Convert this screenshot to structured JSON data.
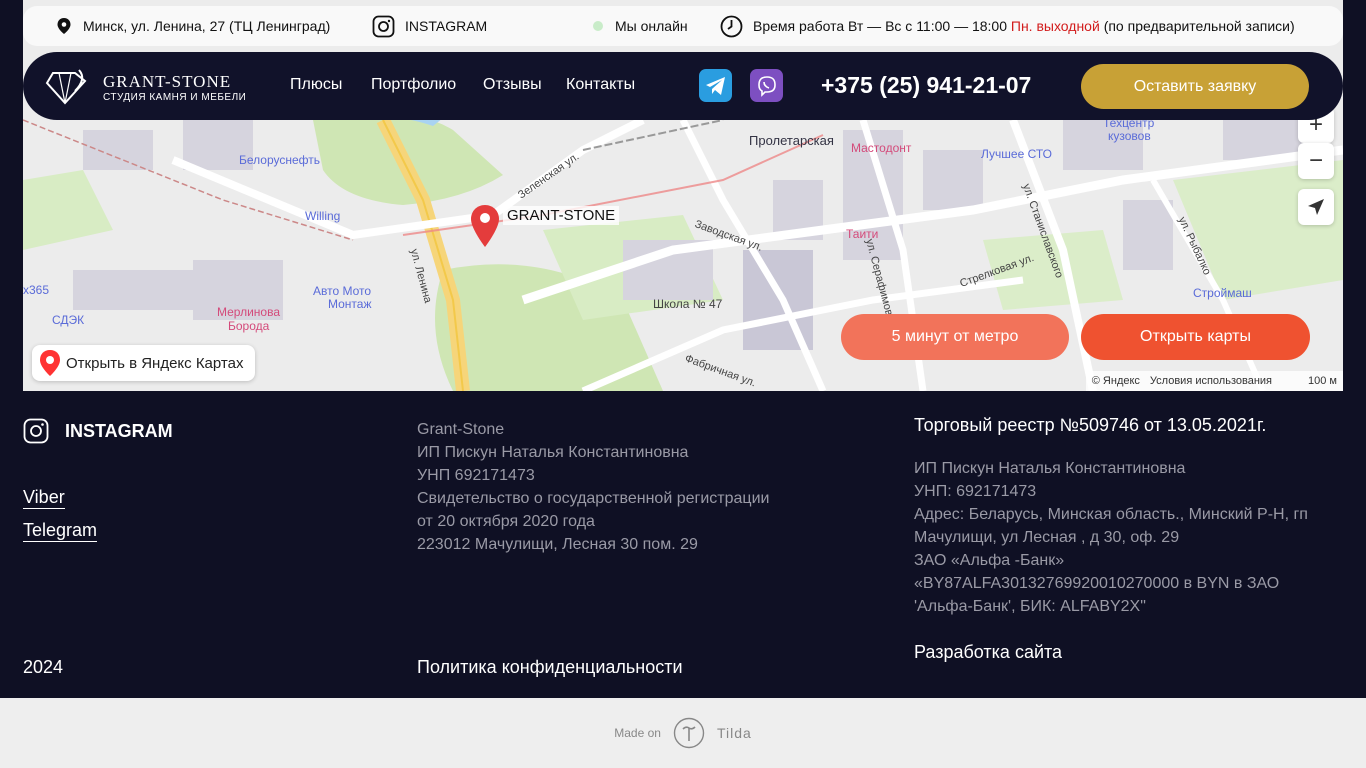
{
  "infobar": {
    "address": "Минск, ул. Ленина, 27 (ТЦ Ленинград)",
    "instagram": "INSTAGRAM",
    "online": "Мы онлайн",
    "hours_prefix": "Время работа Вт — Вс с 11:00 — 18:00",
    "hours_dayoff": "Пн. выходной",
    "hours_suffix": "(по предварительной записи)"
  },
  "navbar": {
    "logo_title": "GRANT-STONE",
    "logo_subtitle": "СТУДИЯ КАМНЯ И МЕБЕЛИ",
    "menu": [
      "Плюсы",
      "Портфолио",
      "Отзывы",
      "Контакты"
    ],
    "phone": "+375 (25) 941-21-07",
    "cta": "Оставить заявку"
  },
  "map": {
    "pin_label": "GRANT-STONE",
    "labels": {
      "metro": "Пролетарская",
      "mastodont": "Мастодонт",
      "sto": "Лучшее СТО",
      "techcentr1": "Техцентр",
      "techcentr2": "кузовов",
      "belorusneft": "Белоруснефть",
      "willing": "Willing",
      "avtomoto1": "Авто Мото",
      "avtomoto2": "Монтаж",
      "merlinova1": "Мерлинова",
      "merlinova2": "Борода",
      "sdek": "СДЭК",
      "school": "Школа № 47",
      "taiti": "Таити",
      "stroymash": "Строймаш",
      "x365": "x365",
      "zavodskaya": "Заводская ул.",
      "lenina": "ул. Ленина",
      "strelkovaya": "Стрелковая ул.",
      "stanislavskogo": "ул. Станиславского",
      "rybalko": "ул. Рыбалко",
      "fabrichnaya": "Фабричная ул.",
      "zelenskaya": "Зеленская ул.",
      "serafimovicha": "ул. Серафимовича"
    },
    "open_yandex": "Открыть в Яндекс Картах",
    "metro_button": "5 минут от метро",
    "maps_button": "Открыть карты",
    "copyright": "© Яндекс",
    "terms": "Условия использования",
    "scale": "100 м"
  },
  "footer": {
    "instagram": "INSTAGRAM",
    "links": [
      "Viber",
      "Telegram"
    ],
    "company_lines": [
      "Grant-Stone",
      "ИП Пискун Наталья Константиновна",
      "УНП 692171473",
      "Свидетельство о государственной регистрации",
      "от 20 октября 2020 года",
      "223012 Мачулищи, Лесная 30 пом. 29"
    ],
    "registry_title": "Торговый реестр №509746 от 13.05.2021г.",
    "registry_lines": [
      "ИП Пискун Наталья Константиновна",
      "УНП: 692171473",
      "Адрес: Беларусь, Минская область., Минский Р-Н, гп",
      "Мачулищи, ул Лесная , д 30, оф. 29",
      "ЗАО «Альфа -Банк»",
      "«BY87ALFA30132769920010270000 в BYN в ЗАО",
      "'Альфа-Банк', БИК: ALFABY2X\""
    ],
    "year": "2024",
    "privacy": "Политика конфиденциальности",
    "dev": "Разработка сайта"
  },
  "tilda": {
    "made_on": "Made on",
    "name": "Tilda"
  },
  "colors": {
    "dark_bg": "#0f1024",
    "gold": "#c8a136",
    "orange": "#ef5230",
    "telegram": "#2a9de0",
    "viber": "#7d4fc1"
  }
}
